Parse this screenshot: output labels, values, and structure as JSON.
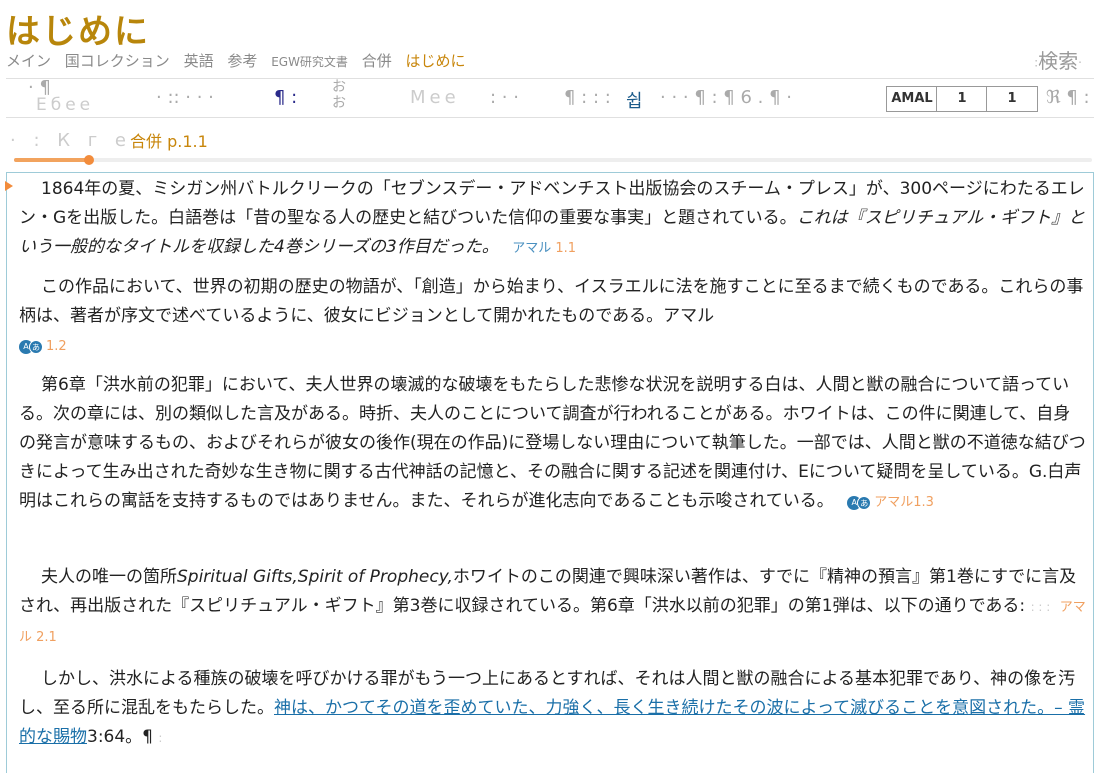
{
  "page": {
    "title": "はじめに"
  },
  "breadcrumb": [
    "メイン",
    "国コレクション",
    "英語",
    "参考",
    "EGW研究文書",
    "合併",
    "はじめに"
  ],
  "search": {
    "label": "検索"
  },
  "toolbar": {
    "a1": "· ¶",
    "a2": "Ебее",
    "a3": "· :: · · ·",
    "a4": "¶ :",
    "a5": "おお",
    "a6": "Мее",
    "a7": ": · ·",
    "a8": "¶ : : :",
    "a9": "쉽",
    "a10": "· · · ¶ : ¶ 6 . ¶ ·",
    "amal": "AMAL",
    "box1": "1",
    "box2": "1",
    "a11": "ℜ ¶ :"
  },
  "subheader": {
    "ghost": "· : К г е",
    "ref": "合併 p.1.1",
    "progress": 0.07
  },
  "paragraphs": [
    {
      "text": "1864年の夏、ミシガン州バトルクリークの「セブンスデー・アドベンチスト出版協会のスチーム・プレス」が、300ページにわたるエレン・Gを出版した。白語巻は「昔の聖なる人の歴史と結びついた信仰の重要な事実」と題されている。",
      "italic": "これは『スピリチュアル・ギフト』という一般的なタイトルを収録した4巻シリーズの3作目だった。",
      "ref_label": "アマル",
      "ref_num": "1.1"
    },
    {
      "text": "この作品において、世界の初期の歴史の物語が、「創造」から始まり、イスラエルに法を施すことに至るまで続くものである。これらの事柄は、著者が序文で述べているように、彼女にビジョンとして開かれたものである。アマル",
      "ref_num": "1.2"
    },
    {
      "text": "第6章「洪水前の犯罪」において、夫人世界の壊滅的な破壊をもたらした悲惨な状況を説明する白は、人間と獣の融合について語っている。次の章には、別の類似した言及がある。時折、夫人のことについて調査が行われることがある。ホワイトは、この件に関連して、自身の発言が意味するもの、およびそれらが彼女の後作(現在の作品)に登場しない理由について執筆した。一部では、人間と獣の不道徳な結びつきによって生み出された奇妙な生き物に関する古代神話の記憶と、その融合に関する記述を関連付け、Eについて疑問を呈している。G.白声明はこれらの寓話を支持するものではありません。また、それらが進化志向であることも示唆されている。",
      "ref_label": "アマル1.3"
    },
    {
      "pre": "夫人の唯一の箇所",
      "italic": "Spiritual Gifts,Spirit of Prophecy,",
      "text": "ホワイトのこの関連で興味深い著作は、すでに『精神の預言』第1巻にすでに言及され、再出版された『スピリチュアル・ギフト』第3巻に収録されている。第6章「洪水以前の犯罪」の第1弾は、以下の通りである:",
      "dots": ": : :",
      "ref_label": "アマル 2.1"
    },
    {
      "text": "しかし、洪水による種族の破壊を呼びかける罪がもう一つ上にあるとすれば、それは人間と獣の融合による基本犯罪であり、神の像を汚し、至る所に混乱をもたらした。",
      "link": "神は、かつてその道を歪めていた、力強く、長く生き続けたその波によって滅びることを意図された。– 霊的な賜物",
      "tail": "3:64。¶",
      "dots": ":"
    }
  ],
  "icon": {
    "badge_left": "A",
    "badge_right": "あ"
  },
  "colors": {
    "accent": "#c8860b",
    "link": "#1a6fa8",
    "ref": "#f0a060",
    "border": "#9ecbd8"
  }
}
